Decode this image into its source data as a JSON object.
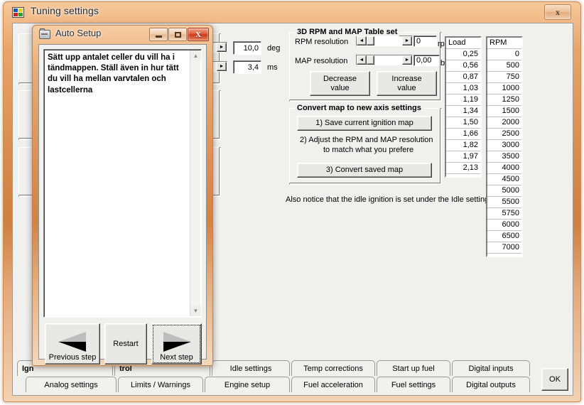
{
  "window": {
    "title": "Tuning settings",
    "icon": "app-icon",
    "close_label": "x"
  },
  "dialog": {
    "title": "Auto Setup",
    "icon": "folder-icon",
    "minimize_label": "minimize",
    "maximize_label": "maximize",
    "close_label": "X",
    "body_text": "Sätt upp antalet celler du vill ha i tändmappen. Ställ även in hur tätt du vill ha mellan varvtalen och lastcellerna",
    "scroll_up": "▲",
    "scroll_down": "▼",
    "buttons": {
      "previous": "Previous step",
      "restart": "Restart",
      "next": "Next step"
    }
  },
  "behind_controls": {
    "value_fields": [
      {
        "value": "10,0",
        "unit": "deg"
      },
      {
        "value": "3,4",
        "unit": "ms"
      }
    ],
    "combo_arrow": "▼"
  },
  "table_set": {
    "group_title": "3D RPM and MAP Table set",
    "rows": [
      {
        "label": "RPM resolution",
        "value": "0",
        "unit": "rpm"
      },
      {
        "label": "MAP resolution",
        "value": "0,00",
        "unit": "bar"
      }
    ],
    "slider_left": "◄",
    "slider_right": "►",
    "decrease_button": "Decrease\nvalue",
    "increase_button": "Increase\nvalue"
  },
  "convert_group": {
    "group_title": "Convert map to new axis settings",
    "step1_button": "1) Save current ignition map",
    "step2_text_line1": "2) Adjust the RPM and MAP resolution",
    "step2_text_line2": "to match what you prefere",
    "step3_button": "3) Convert saved map"
  },
  "notice_text": "Also notice that the idle ignition is set under the Idle settings",
  "load_table": {
    "header": "Load",
    "values": [
      "0,25",
      "0,56",
      "0,87",
      "1,03",
      "1,19",
      "1,34",
      "1,50",
      "1,66",
      "1,82",
      "1,97",
      "2,13"
    ]
  },
  "rpm_table": {
    "header": "RPM",
    "values": [
      "0",
      "500",
      "750",
      "1000",
      "1250",
      "1500",
      "2000",
      "2500",
      "3000",
      "3500",
      "4000",
      "4500",
      "5000",
      "5500",
      "5750",
      "6000",
      "6500",
      "7000"
    ]
  },
  "tabs": {
    "row1": [
      {
        "label": "Ign",
        "truncated": true
      },
      {
        "label": "trol",
        "truncated": true
      },
      {
        "label": "Idle settings",
        "truncated": false
      },
      {
        "label": "Temp corrections",
        "truncated": false
      },
      {
        "label": "Start up fuel",
        "truncated": false
      },
      {
        "label": "Digital inputs",
        "truncated": false
      }
    ],
    "row2": [
      {
        "label": "Analog settings"
      },
      {
        "label": "Limits / Warnings"
      },
      {
        "label": "Engine setup"
      },
      {
        "label": "Fuel acceleration"
      },
      {
        "label": "Fuel settings"
      },
      {
        "label": "Digital outputs"
      }
    ]
  },
  "ok_button": {
    "label": "OK"
  },
  "colors": {
    "window_frame": "#d98c4c",
    "dialog_frame": "#dd9050",
    "close_red": "#c8391b",
    "client_bg": "#f0f0ee"
  }
}
